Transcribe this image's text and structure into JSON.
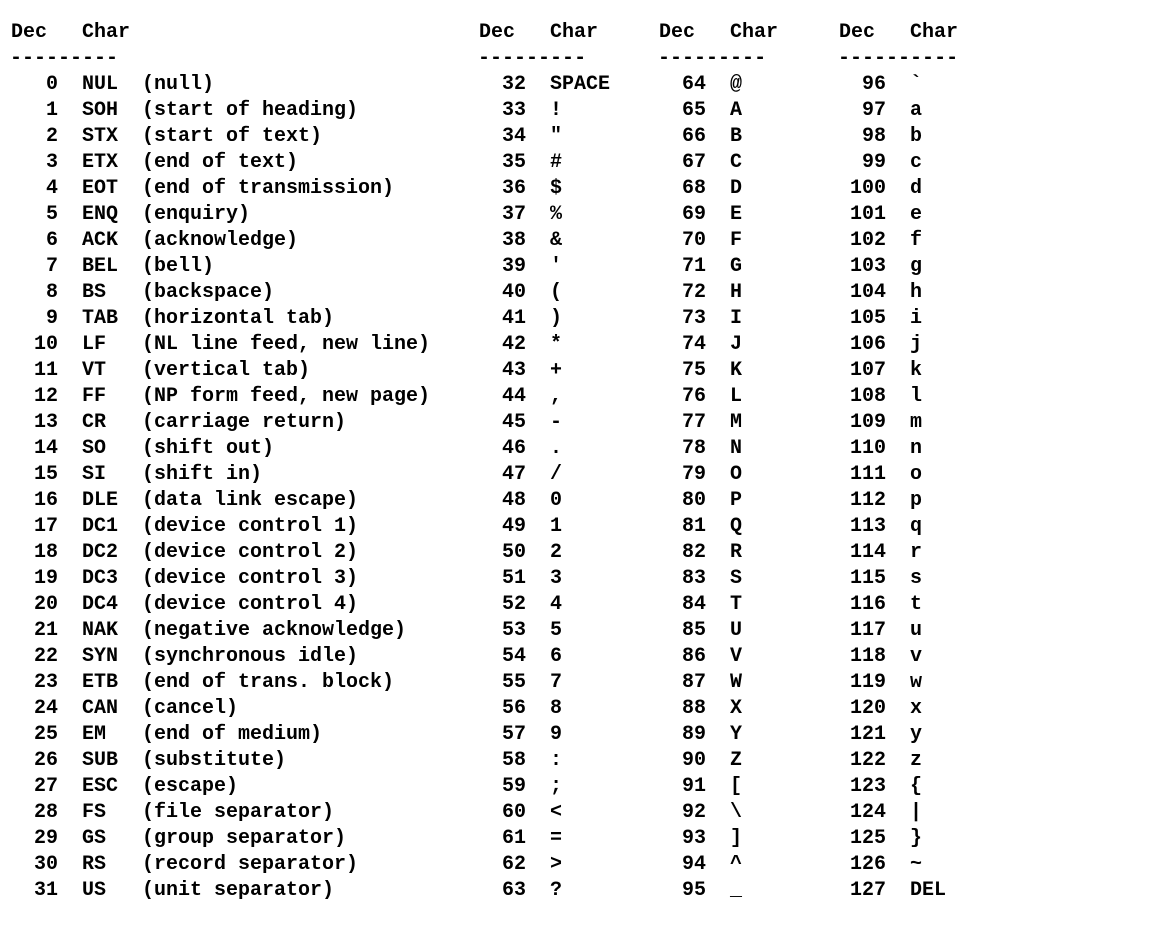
{
  "headers": {
    "dec": "Dec",
    "char": "Char"
  },
  "rule_narrow": "---------",
  "rule_wide": "----------",
  "columns": [
    {
      "wide": true,
      "rows": [
        {
          "dec": "0",
          "char": "NUL",
          "desc": "(null)"
        },
        {
          "dec": "1",
          "char": "SOH",
          "desc": "(start of heading)"
        },
        {
          "dec": "2",
          "char": "STX",
          "desc": "(start of text)"
        },
        {
          "dec": "3",
          "char": "ETX",
          "desc": "(end of text)"
        },
        {
          "dec": "4",
          "char": "EOT",
          "desc": "(end of transmission)"
        },
        {
          "dec": "5",
          "char": "ENQ",
          "desc": "(enquiry)"
        },
        {
          "dec": "6",
          "char": "ACK",
          "desc": "(acknowledge)"
        },
        {
          "dec": "7",
          "char": "BEL",
          "desc": "(bell)"
        },
        {
          "dec": "8",
          "char": "BS",
          "desc": "(backspace)"
        },
        {
          "dec": "9",
          "char": "TAB",
          "desc": "(horizontal tab)"
        },
        {
          "dec": "10",
          "char": "LF",
          "desc": "(NL line feed, new line)"
        },
        {
          "dec": "11",
          "char": "VT",
          "desc": "(vertical tab)"
        },
        {
          "dec": "12",
          "char": "FF",
          "desc": "(NP form feed, new page)"
        },
        {
          "dec": "13",
          "char": "CR",
          "desc": "(carriage return)"
        },
        {
          "dec": "14",
          "char": "SO",
          "desc": "(shift out)"
        },
        {
          "dec": "15",
          "char": "SI",
          "desc": "(shift in)"
        },
        {
          "dec": "16",
          "char": "DLE",
          "desc": "(data link escape)"
        },
        {
          "dec": "17",
          "char": "DC1",
          "desc": "(device control 1)"
        },
        {
          "dec": "18",
          "char": "DC2",
          "desc": "(device control 2)"
        },
        {
          "dec": "19",
          "char": "DC3",
          "desc": "(device control 3)"
        },
        {
          "dec": "20",
          "char": "DC4",
          "desc": "(device control 4)"
        },
        {
          "dec": "21",
          "char": "NAK",
          "desc": "(negative acknowledge)"
        },
        {
          "dec": "22",
          "char": "SYN",
          "desc": "(synchronous idle)"
        },
        {
          "dec": "23",
          "char": "ETB",
          "desc": "(end of trans. block)"
        },
        {
          "dec": "24",
          "char": "CAN",
          "desc": "(cancel)"
        },
        {
          "dec": "25",
          "char": "EM",
          "desc": "(end of medium)"
        },
        {
          "dec": "26",
          "char": "SUB",
          "desc": "(substitute)"
        },
        {
          "dec": "27",
          "char": "ESC",
          "desc": "(escape)"
        },
        {
          "dec": "28",
          "char": "FS",
          "desc": "(file separator)"
        },
        {
          "dec": "29",
          "char": "GS",
          "desc": "(group separator)"
        },
        {
          "dec": "30",
          "char": "RS",
          "desc": "(record separator)"
        },
        {
          "dec": "31",
          "char": "US",
          "desc": "(unit separator)"
        }
      ]
    },
    {
      "wide": false,
      "rows": [
        {
          "dec": "32",
          "char": "SPACE"
        },
        {
          "dec": "33",
          "char": "!"
        },
        {
          "dec": "34",
          "char": "\""
        },
        {
          "dec": "35",
          "char": "#"
        },
        {
          "dec": "36",
          "char": "$"
        },
        {
          "dec": "37",
          "char": "%"
        },
        {
          "dec": "38",
          "char": "&"
        },
        {
          "dec": "39",
          "char": "'"
        },
        {
          "dec": "40",
          "char": "("
        },
        {
          "dec": "41",
          "char": ")"
        },
        {
          "dec": "42",
          "char": "*"
        },
        {
          "dec": "43",
          "char": "+"
        },
        {
          "dec": "44",
          "char": ","
        },
        {
          "dec": "45",
          "char": "-"
        },
        {
          "dec": "46",
          "char": "."
        },
        {
          "dec": "47",
          "char": "/"
        },
        {
          "dec": "48",
          "char": "0"
        },
        {
          "dec": "49",
          "char": "1"
        },
        {
          "dec": "50",
          "char": "2"
        },
        {
          "dec": "51",
          "char": "3"
        },
        {
          "dec": "52",
          "char": "4"
        },
        {
          "dec": "53",
          "char": "5"
        },
        {
          "dec": "54",
          "char": "6"
        },
        {
          "dec": "55",
          "char": "7"
        },
        {
          "dec": "56",
          "char": "8"
        },
        {
          "dec": "57",
          "char": "9"
        },
        {
          "dec": "58",
          "char": ":"
        },
        {
          "dec": "59",
          "char": ";"
        },
        {
          "dec": "60",
          "char": "<"
        },
        {
          "dec": "61",
          "char": "="
        },
        {
          "dec": "62",
          "char": ">"
        },
        {
          "dec": "63",
          "char": "?"
        }
      ]
    },
    {
      "wide": false,
      "rows": [
        {
          "dec": "64",
          "char": "@"
        },
        {
          "dec": "65",
          "char": "A"
        },
        {
          "dec": "66",
          "char": "B"
        },
        {
          "dec": "67",
          "char": "C"
        },
        {
          "dec": "68",
          "char": "D"
        },
        {
          "dec": "69",
          "char": "E"
        },
        {
          "dec": "70",
          "char": "F"
        },
        {
          "dec": "71",
          "char": "G"
        },
        {
          "dec": "72",
          "char": "H"
        },
        {
          "dec": "73",
          "char": "I"
        },
        {
          "dec": "74",
          "char": "J"
        },
        {
          "dec": "75",
          "char": "K"
        },
        {
          "dec": "76",
          "char": "L"
        },
        {
          "dec": "77",
          "char": "M"
        },
        {
          "dec": "78",
          "char": "N"
        },
        {
          "dec": "79",
          "char": "O"
        },
        {
          "dec": "80",
          "char": "P"
        },
        {
          "dec": "81",
          "char": "Q"
        },
        {
          "dec": "82",
          "char": "R"
        },
        {
          "dec": "83",
          "char": "S"
        },
        {
          "dec": "84",
          "char": "T"
        },
        {
          "dec": "85",
          "char": "U"
        },
        {
          "dec": "86",
          "char": "V"
        },
        {
          "dec": "87",
          "char": "W"
        },
        {
          "dec": "88",
          "char": "X"
        },
        {
          "dec": "89",
          "char": "Y"
        },
        {
          "dec": "90",
          "char": "Z"
        },
        {
          "dec": "91",
          "char": "["
        },
        {
          "dec": "92",
          "char": "\\"
        },
        {
          "dec": "93",
          "char": "]"
        },
        {
          "dec": "94",
          "char": "^"
        },
        {
          "dec": "95",
          "char": "_"
        }
      ]
    },
    {
      "wide": false,
      "rule_override": "----------",
      "rows": [
        {
          "dec": "96",
          "char": "`"
        },
        {
          "dec": "97",
          "char": "a"
        },
        {
          "dec": "98",
          "char": "b"
        },
        {
          "dec": "99",
          "char": "c"
        },
        {
          "dec": "100",
          "char": "d"
        },
        {
          "dec": "101",
          "char": "e"
        },
        {
          "dec": "102",
          "char": "f"
        },
        {
          "dec": "103",
          "char": "g"
        },
        {
          "dec": "104",
          "char": "h"
        },
        {
          "dec": "105",
          "char": "i"
        },
        {
          "dec": "106",
          "char": "j"
        },
        {
          "dec": "107",
          "char": "k"
        },
        {
          "dec": "108",
          "char": "l"
        },
        {
          "dec": "109",
          "char": "m"
        },
        {
          "dec": "110",
          "char": "n"
        },
        {
          "dec": "111",
          "char": "o"
        },
        {
          "dec": "112",
          "char": "p"
        },
        {
          "dec": "113",
          "char": "q"
        },
        {
          "dec": "114",
          "char": "r"
        },
        {
          "dec": "115",
          "char": "s"
        },
        {
          "dec": "116",
          "char": "t"
        },
        {
          "dec": "117",
          "char": "u"
        },
        {
          "dec": "118",
          "char": "v"
        },
        {
          "dec": "119",
          "char": "w"
        },
        {
          "dec": "120",
          "char": "x"
        },
        {
          "dec": "121",
          "char": "y"
        },
        {
          "dec": "122",
          "char": "z"
        },
        {
          "dec": "123",
          "char": "{"
        },
        {
          "dec": "124",
          "char": "|"
        },
        {
          "dec": "125",
          "char": "}"
        },
        {
          "dec": "126",
          "char": "~"
        },
        {
          "dec": "127",
          "char": "DEL"
        }
      ]
    }
  ]
}
